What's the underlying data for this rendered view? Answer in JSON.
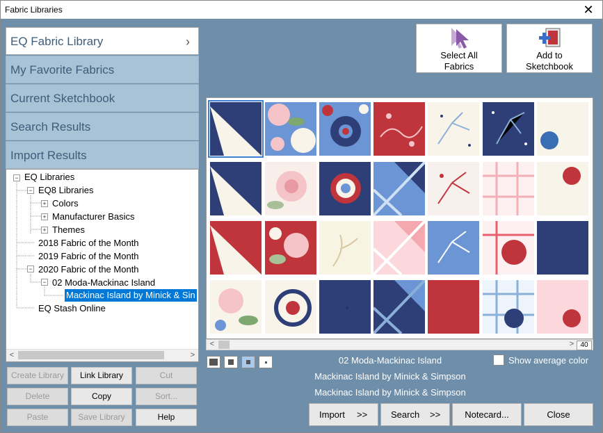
{
  "window": {
    "title": "Fabric Libraries",
    "close_glyph": "✕"
  },
  "nav": {
    "items": [
      {
        "label": "EQ Fabric Library",
        "active": true
      },
      {
        "label": "My Favorite Fabrics"
      },
      {
        "label": "Current Sketchbook"
      },
      {
        "label": "Search Results"
      },
      {
        "label": "Import Results"
      }
    ],
    "chevron": "›"
  },
  "tree": {
    "root": "EQ Libraries",
    "eq8": "EQ8 Libraries",
    "colors": "Colors",
    "manufacturer": "Manufacturer Basics",
    "themes": "Themes",
    "fom2018": "2018 Fabric of the Month",
    "fom2019": "2019 Fabric of the Month",
    "fom2020": "2020 Fabric of the Month",
    "moda": "02 Moda-Mackinac Island",
    "selected": "Mackinac Island by Minick & Sin",
    "stash": "EQ Stash Online"
  },
  "left_buttons": {
    "create_library": "Create Library",
    "link_library": "Link Library",
    "cut": "Cut",
    "delete": "Delete",
    "copy": "Copy",
    "sort": "Sort...",
    "paste": "Paste",
    "save_library": "Save Library",
    "help": "Help"
  },
  "top_buttons": {
    "select_all": [
      "Select All",
      "Fabrics"
    ],
    "add_to_sketchbook": [
      "Add to",
      "Sketchbook"
    ]
  },
  "grid": {
    "page": "40",
    "colors": {
      "navy": "#2e3f78",
      "red": "#c0353b",
      "blue": "#6b95d4",
      "cream": "#f8f4ea",
      "pink": "#f4c4c8"
    }
  },
  "info": {
    "line1": "02 Moda-Mackinac Island",
    "line2": "Mackinac Island by Minick & Simpson",
    "line3": "Mackinac Island by Minick & Simpson"
  },
  "show_average": "Show average color",
  "bottom_buttons": {
    "import": "Import",
    "import_arrow": ">>",
    "search": "Search",
    "search_arrow": ">>",
    "notecard": "Notecard...",
    "close": "Close"
  }
}
